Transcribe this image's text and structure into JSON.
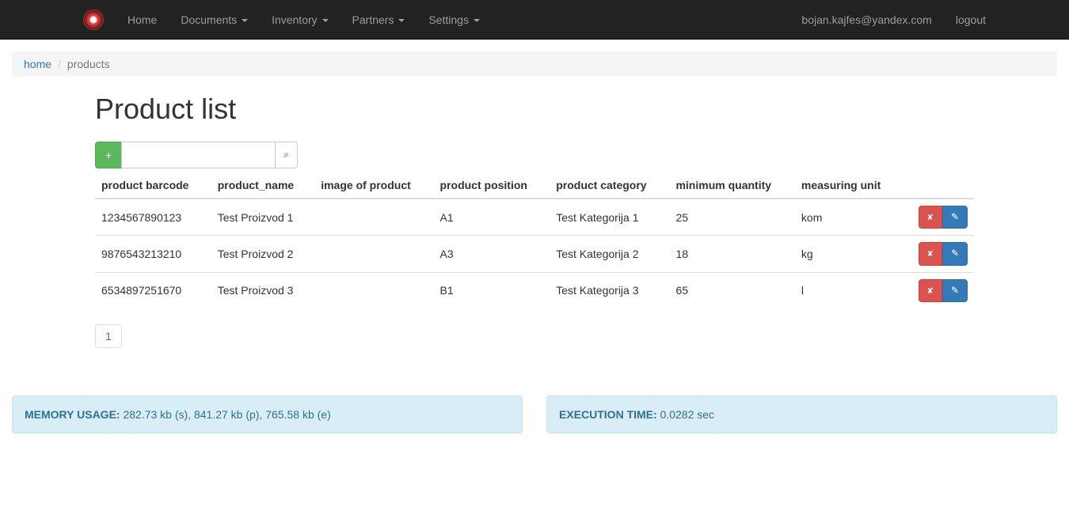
{
  "nav": {
    "items": [
      {
        "label": "Home"
      },
      {
        "label": "Documents",
        "dropdown": true
      },
      {
        "label": "Inventory",
        "dropdown": true
      },
      {
        "label": "Partners",
        "dropdown": true
      },
      {
        "label": "Settings",
        "dropdown": true
      }
    ],
    "user_email": "bojan.kajfes@yandex.com",
    "logout": "logout"
  },
  "breadcrumb": {
    "home": "home",
    "current": "products"
  },
  "page_title": "Product list",
  "toolbar": {
    "add_label": "+",
    "search_value": ""
  },
  "table": {
    "headers": [
      "product barcode",
      "product_name",
      "image of product",
      "product position",
      "product category",
      "minimum quantity",
      "measuring unit"
    ],
    "rows": [
      {
        "barcode": "1234567890123",
        "name": "Test Proizvod 1",
        "image": "",
        "position": "A1",
        "category": "Test Kategorija 1",
        "min_qty": "25",
        "unit": "kom"
      },
      {
        "barcode": "9876543213210",
        "name": "Test Proizvod 2",
        "image": "",
        "position": "A3",
        "category": "Test Kategorija 2",
        "min_qty": "18",
        "unit": "kg"
      },
      {
        "barcode": "6534897251670",
        "name": "Test Proizvod 3",
        "image": "",
        "position": "B1",
        "category": "Test Kategorija 3",
        "min_qty": "65",
        "unit": "l"
      }
    ]
  },
  "pagination": {
    "page": "1"
  },
  "footer": {
    "memory_label": "MEMORY USAGE:",
    "memory_value": " 282.73 kb (s), 841.27 kb (p), 765.58 kb (e)",
    "exec_label": "EXECUTION TIME:",
    "exec_value": " 0.0282 sec"
  }
}
